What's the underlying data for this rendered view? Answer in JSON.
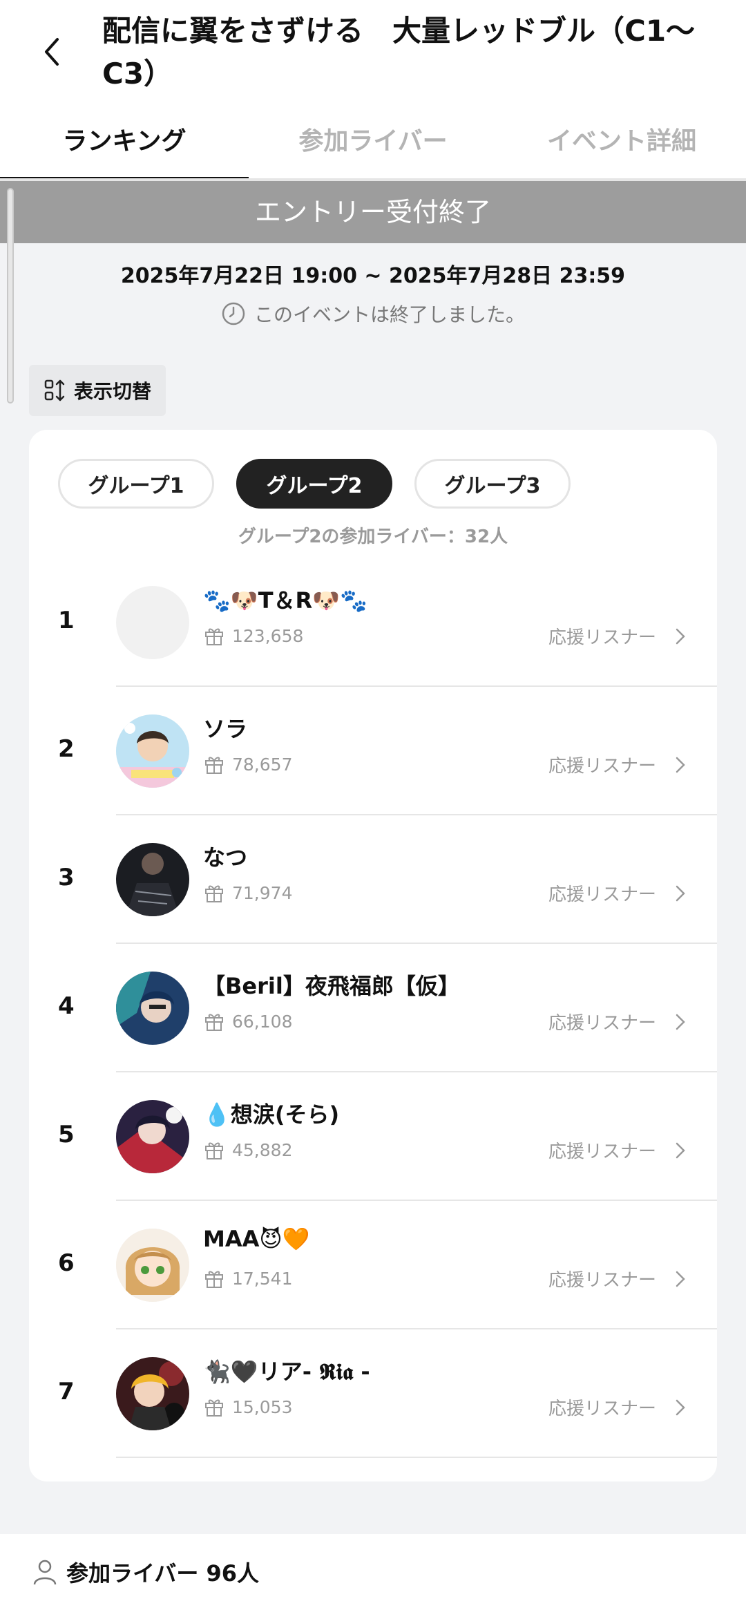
{
  "header": {
    "title": "配信に翼をさずける　大量レッドブル（C1〜C3）"
  },
  "tabs": [
    {
      "label": "ランキング"
    },
    {
      "label": "参加ライバー"
    },
    {
      "label": "イベント詳細"
    }
  ],
  "banner": "エントリー受付終了",
  "period": "2025年7月22日 19:00 ~ 2025年7月28日 23:59",
  "ended_text": "このイベントは終了しました。",
  "switch_label": "表示切替",
  "groups": [
    {
      "label": "グループ1"
    },
    {
      "label": "グループ2"
    },
    {
      "label": "グループ3"
    }
  ],
  "group_count": "グループ2の参加ライバー：32人",
  "support_label": "応援リスナー",
  "ranking": [
    {
      "rank": "1",
      "name": "🐾🐶T＆R🐶🐾",
      "score": "123,658"
    },
    {
      "rank": "2",
      "name": "ソラ",
      "score": "78,657"
    },
    {
      "rank": "3",
      "name": "なつ",
      "score": "71,974"
    },
    {
      "rank": "4",
      "name": "【Beril】夜飛福郎【仮】",
      "score": "66,108"
    },
    {
      "rank": "5",
      "name": "💧想涙(そら)",
      "score": "45,882"
    },
    {
      "rank": "6",
      "name": "MAA😈🧡",
      "score": "17,541"
    },
    {
      "rank": "7",
      "name": "🐈‍⬛🖤リア- 𝕽𝖎𝖆 -",
      "score": "15,053"
    }
  ],
  "footer": {
    "label": "参加ライバー 96人"
  }
}
